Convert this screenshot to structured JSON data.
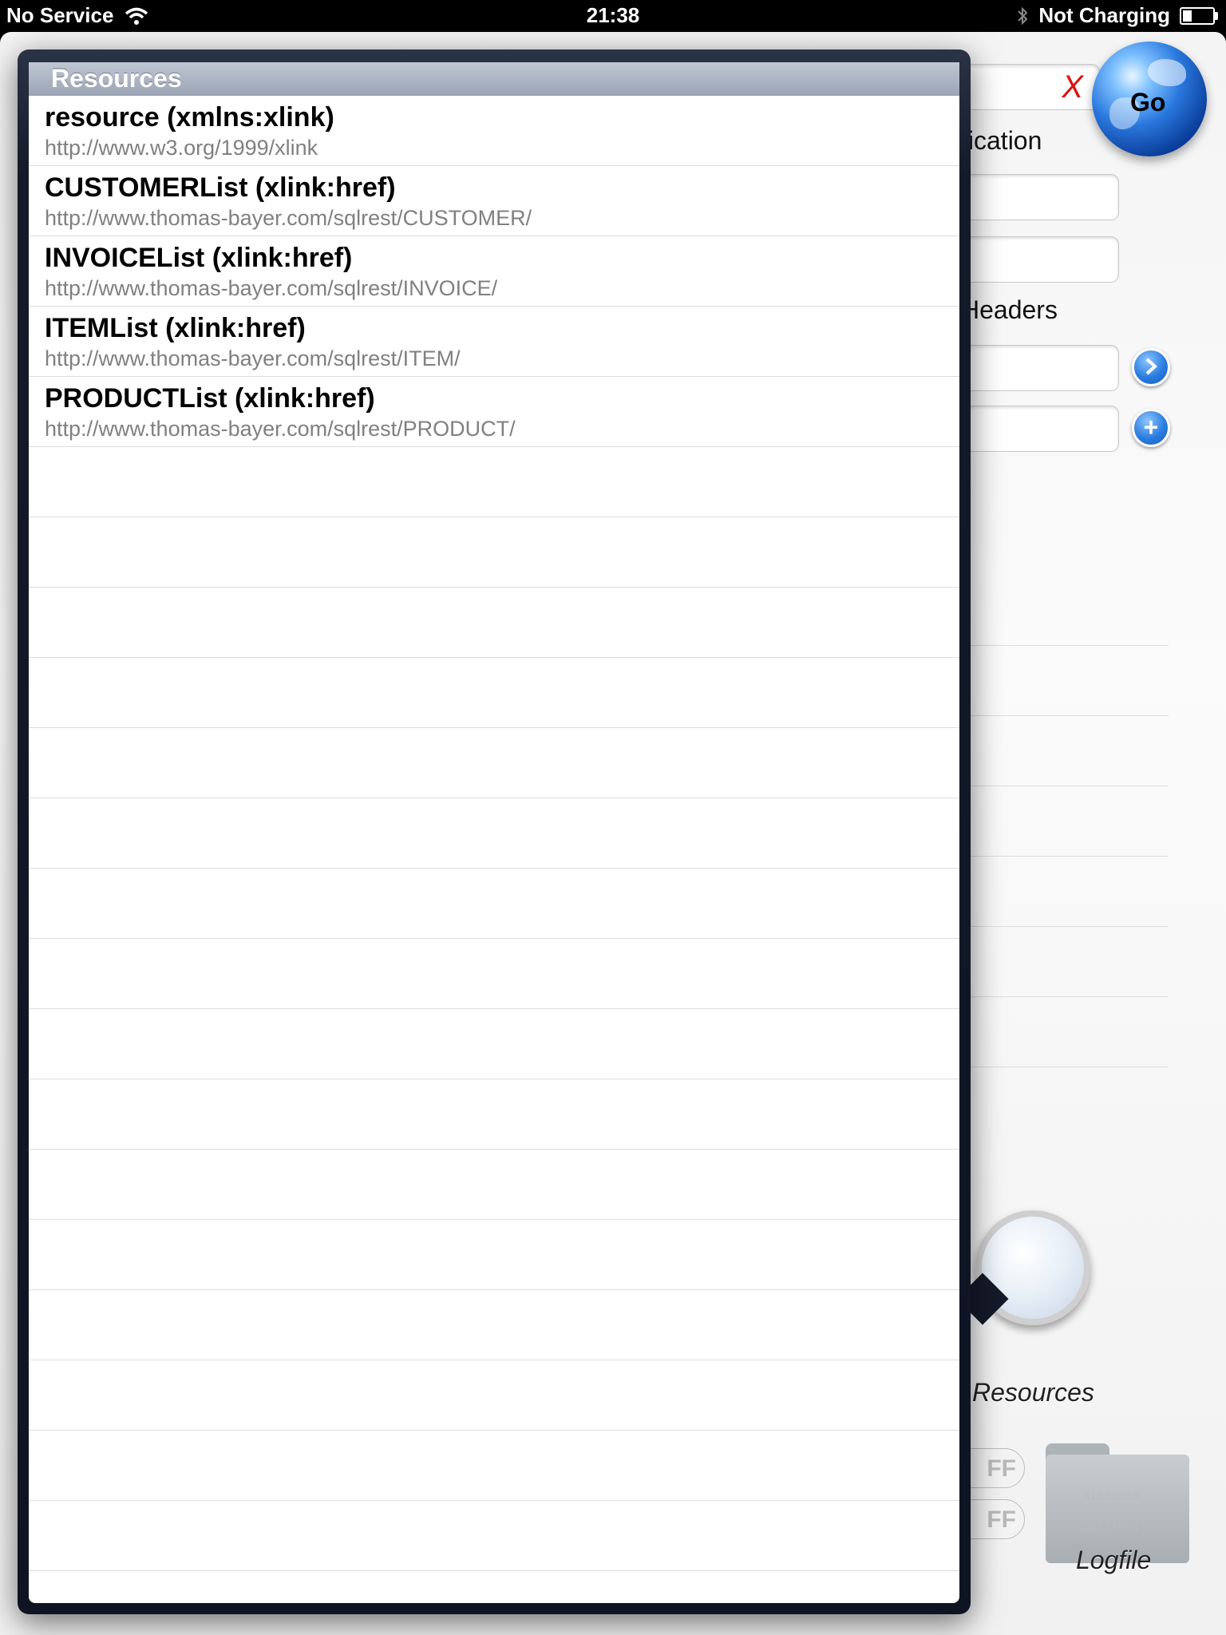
{
  "status_bar": {
    "carrier": "No Service",
    "time": "21:38",
    "charging": "Not Charging",
    "battery_level": 0.3
  },
  "background": {
    "clear_button": "X",
    "go_label": "Go",
    "authentication_label": "tication",
    "headers_label": "Headers",
    "resources_label": "Resources",
    "off_switches": [
      "FF",
      "FF"
    ],
    "logfile_label": "Logfile",
    "logfile_bits": [
      "01010010",
      "01100101",
      "10111001"
    ]
  },
  "popover": {
    "title": "Resources",
    "items": [
      {
        "title": "resource (xmlns:xlink)",
        "url": "http://www.w3.org/1999/xlink"
      },
      {
        "title": "CUSTOMERList (xlink:href)",
        "url": "http://www.thomas-bayer.com/sqlrest/CUSTOMER/"
      },
      {
        "title": "INVOICEList (xlink:href)",
        "url": "http://www.thomas-bayer.com/sqlrest/INVOICE/"
      },
      {
        "title": "ITEMList (xlink:href)",
        "url": "http://www.thomas-bayer.com/sqlrest/ITEM/"
      },
      {
        "title": "PRODUCTList (xlink:href)",
        "url": "http://www.thomas-bayer.com/sqlrest/PRODUCT/"
      }
    ]
  },
  "colors": {
    "accent_blue": "#2a7de0",
    "clear_red": "#dd1111",
    "popover_frame": "#141a29"
  }
}
